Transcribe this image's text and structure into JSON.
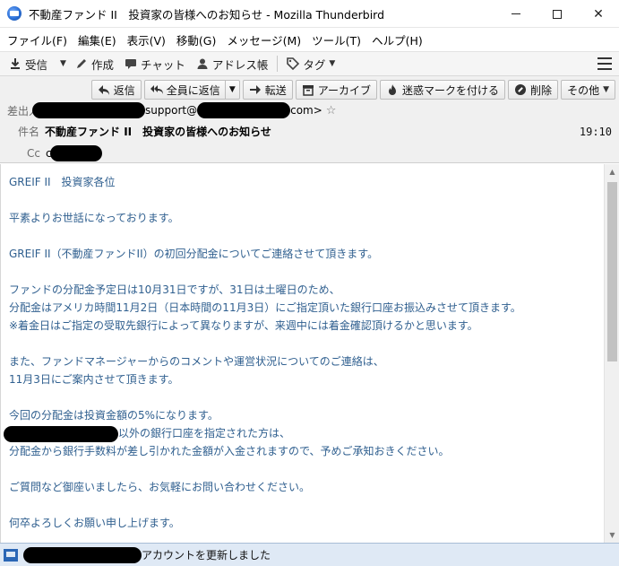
{
  "window": {
    "title": "不動産ファンド II　投資家の皆様へのお知らせ - Mozilla Thunderbird",
    "minimize_icon": "minimize-icon",
    "maximize_icon": "maximize-icon",
    "close_label": "✕"
  },
  "menubar": [
    {
      "label": "ファイル(F)"
    },
    {
      "label": "編集(E)"
    },
    {
      "label": "表示(V)"
    },
    {
      "label": "移動(G)"
    },
    {
      "label": "メッセージ(M)"
    },
    {
      "label": "ツール(T)"
    },
    {
      "label": "ヘルプ(H)"
    }
  ],
  "toolbar": {
    "receive": "受信",
    "compose": "作成",
    "chat": "チャット",
    "addressbook": "アドレス帳",
    "tag": "タグ"
  },
  "header_actions": {
    "reply": "返信",
    "reply_all": "全員に返信",
    "forward": "転送",
    "archive": "アーカイブ",
    "junk": "迷惑マークを付ける",
    "delete": "削除",
    "other": "その他"
  },
  "header": {
    "from_label": "差出人",
    "from_visible_part1": "support@",
    "from_visible_part2": "com>",
    "subject_label": "件名",
    "subject": "不動産ファンド II　投資家の皆様へのお知らせ",
    "time": "19:10",
    "cc_label": "Cc",
    "cc_visible": "c"
  },
  "body": {
    "lines": [
      "GREIF II　投資家各位",
      "",
      "平素よりお世話になっております。",
      "",
      "GREIF II（不動産ファンドII）の初回分配金についてご連絡させて頂きます。",
      "",
      "ファンドの分配金予定日は10月31日ですが、31日は土曜日のため、",
      "分配金はアメリカ時間11月2日（日本時間の11月3日）にご指定頂いた銀行口座お振込みさせて頂きます。",
      "※着金日はご指定の受取先銀行によって異なりますが、来週中には着金確認頂けるかと思います。",
      "",
      "また、ファンドマネージャーからのコメントや運営状況についてのご連絡は、",
      "11月3日にご案内させて頂きます。",
      "",
      "今回の分配金は投資金額の5%になります。",
      "以外の銀行口座を指定された方は、",
      "分配金から銀行手数料が差し引かれた金額が入金されますので、予めご承知おきください。",
      "",
      "ご質問など御座いましたら、お気軽にお問い合わせください。",
      "",
      "何卒よろしくお願い申し上げます。"
    ]
  },
  "status": {
    "text": "アカウントを更新しました"
  },
  "colors": {
    "body_text": "#2f5f8f",
    "statusbar_bg": "#dfe9f5",
    "header_bg": "#f0f0f0"
  }
}
